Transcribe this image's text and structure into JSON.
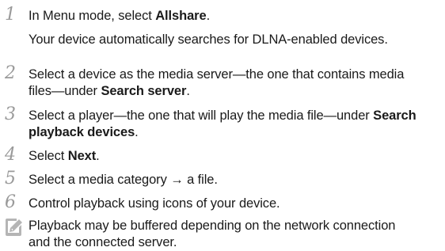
{
  "steps": [
    {
      "number": "1",
      "lines": [
        {
          "parts": [
            {
              "text": "In Menu mode, select ",
              "bold": false
            },
            {
              "text": "Allshare",
              "bold": true
            },
            {
              "text": ".",
              "bold": false
            }
          ]
        },
        {
          "parts": [
            {
              "text": "Your device automatically searches for DLNA-enabled devices.",
              "bold": false
            }
          ]
        }
      ]
    },
    {
      "number": "2",
      "lines": [
        {
          "parts": [
            {
              "text": "Select a device as the media server—the one that contains media",
              "bold": false
            }
          ]
        },
        {
          "parts": [
            {
              "text": "files—under ",
              "bold": false
            },
            {
              "text": "Search server",
              "bold": true
            },
            {
              "text": ".",
              "bold": false
            }
          ]
        }
      ]
    },
    {
      "number": "3",
      "lines": [
        {
          "parts": [
            {
              "text": "Select a player—the one that will play the media file—under ",
              "bold": false
            },
            {
              "text": "Search",
              "bold": true
            }
          ]
        },
        {
          "parts": [
            {
              "text": "playback devices",
              "bold": true
            },
            {
              "text": ".",
              "bold": false
            }
          ]
        }
      ]
    },
    {
      "number": "4",
      "lines": [
        {
          "parts": [
            {
              "text": "Select ",
              "bold": false
            },
            {
              "text": "Next",
              "bold": true
            },
            {
              "text": ".",
              "bold": false
            }
          ]
        }
      ]
    },
    {
      "number": "5",
      "lines": [
        {
          "parts": [
            {
              "text": "Select a media category → a file.",
              "bold": false
            }
          ]
        }
      ]
    },
    {
      "number": "6",
      "lines": [
        {
          "parts": [
            {
              "text": "Control playback using icons of your device.",
              "bold": false
            }
          ]
        }
      ]
    }
  ],
  "note": {
    "icon": "note-pencil-icon",
    "lines": [
      "Playback may be buffered depending on the network connection",
      "and the connected server."
    ]
  },
  "colors": {
    "step_number": "#9a9a9a",
    "note_icon": "#b5b5b5",
    "text": "#1a1a1a"
  }
}
